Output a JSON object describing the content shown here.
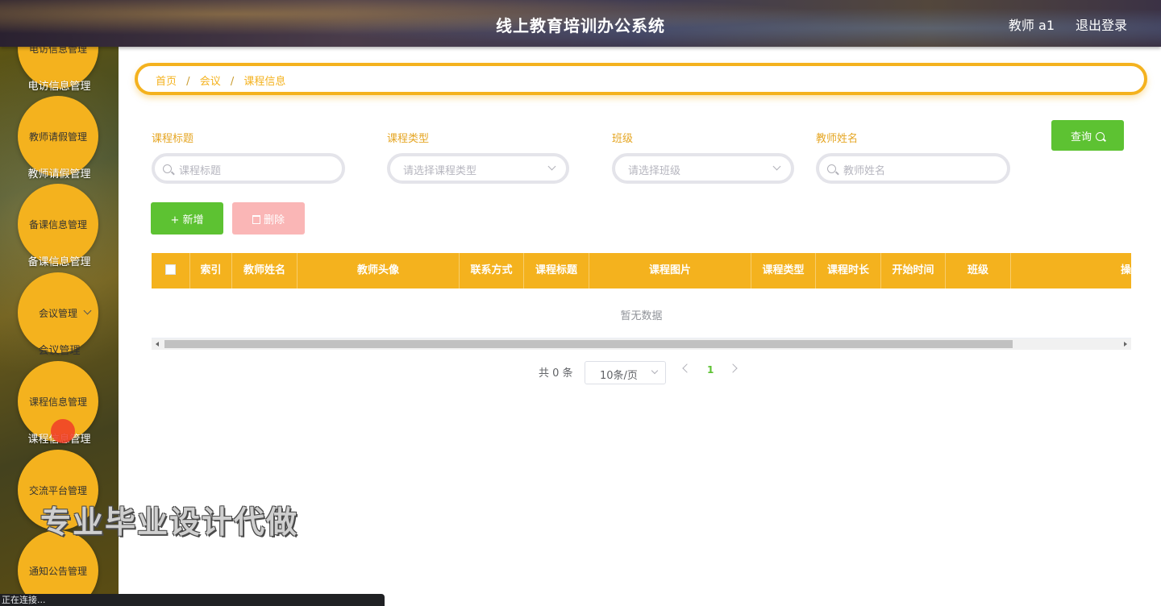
{
  "header": {
    "title": "线上教育培训办公系统",
    "user": "教师 a1",
    "logout": "退出登录"
  },
  "sidebar": {
    "items": [
      {
        "circle_label": "电访信息管理",
        "sub_label": "电访信息管理"
      },
      {
        "circle_label": "教师请假管理",
        "sub_label": "教师请假管理"
      },
      {
        "circle_label": "备课信息管理",
        "sub_label": "备课信息管理"
      },
      {
        "circle_label": "会议管理",
        "sub_label": "会议管理"
      },
      {
        "circle_label": "课程信息管理",
        "sub_label": "课程信息管理"
      },
      {
        "circle_label": "交流平台管理",
        "sub_label": ""
      },
      {
        "circle_label": "通知公告管理",
        "sub_label": ""
      }
    ]
  },
  "breadcrumb": {
    "home": "首页",
    "sep": "/",
    "level1": "会议",
    "level2": "课程信息"
  },
  "search": {
    "title_label": "课程标题",
    "title_placeholder": "课程标题",
    "type_label": "课程类型",
    "type_placeholder": "请选择课程类型",
    "class_label": "班级",
    "class_placeholder": "请选择班级",
    "teacher_label": "教师姓名",
    "teacher_placeholder": "教师姓名",
    "query_button": "查询"
  },
  "actions": {
    "add": "+ 新增",
    "delete": "删除"
  },
  "table": {
    "columns": [
      "索引",
      "教师姓名",
      "教师头像",
      "联系方式",
      "课程标题",
      "课程图片",
      "课程类型",
      "课程时长",
      "开始时间",
      "班级",
      "操"
    ],
    "empty_text": "暂无数据"
  },
  "pagination": {
    "total": "共 0 条",
    "page_size": "10条/页",
    "current_page": "1"
  },
  "watermark": "专业毕业设计代做",
  "status_text": "正在连接..."
}
